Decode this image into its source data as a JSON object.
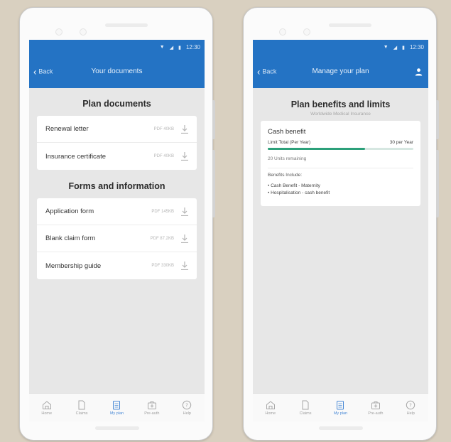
{
  "status": {
    "time": "12:30"
  },
  "colors": {
    "primary": "#2473c4",
    "progress": "#2ca07a",
    "nav_active": "#4a8ad6"
  },
  "left_screen": {
    "back_label": "Back",
    "title": "Your documents",
    "plan_documents_heading": "Plan documents",
    "plan_documents": [
      {
        "name": "Renewal letter",
        "meta": "PDF 40KB"
      },
      {
        "name": "Insurance certificate",
        "meta": "PDF 40KB"
      }
    ],
    "forms_heading": "Forms and information",
    "forms": [
      {
        "name": "Application form",
        "meta": "PDF 145KB"
      },
      {
        "name": "Blank claim form",
        "meta": "PDF 87.2KB"
      },
      {
        "name": "Membership guide",
        "meta": "PDF 330KB"
      }
    ]
  },
  "right_screen": {
    "back_label": "Back",
    "title": "Manage your plan",
    "heading": "Plan benefits and limits",
    "subtitle": "Worldwide Medical Insurance",
    "benefit": {
      "title": "Cash benefit",
      "limit_label": "Limit Total (Per Year)",
      "limit_value": "30 per Year",
      "progress_fraction": 0.67,
      "units_remaining": "20 Units remaining",
      "includes_label": "Benefits Include:",
      "includes": [
        "Cash Benefit - Maternity",
        "Hospitalisation - cash benefit"
      ]
    }
  },
  "nav": [
    {
      "label": "Home",
      "icon": "home-icon",
      "active": false
    },
    {
      "label": "Claims",
      "icon": "document-icon",
      "active": false
    },
    {
      "label": "My plan",
      "icon": "clipboard-icon",
      "active": true
    },
    {
      "label": "Pre-auth",
      "icon": "medical-bag-icon",
      "active": false
    },
    {
      "label": "Help",
      "icon": "help-icon",
      "active": false
    }
  ]
}
